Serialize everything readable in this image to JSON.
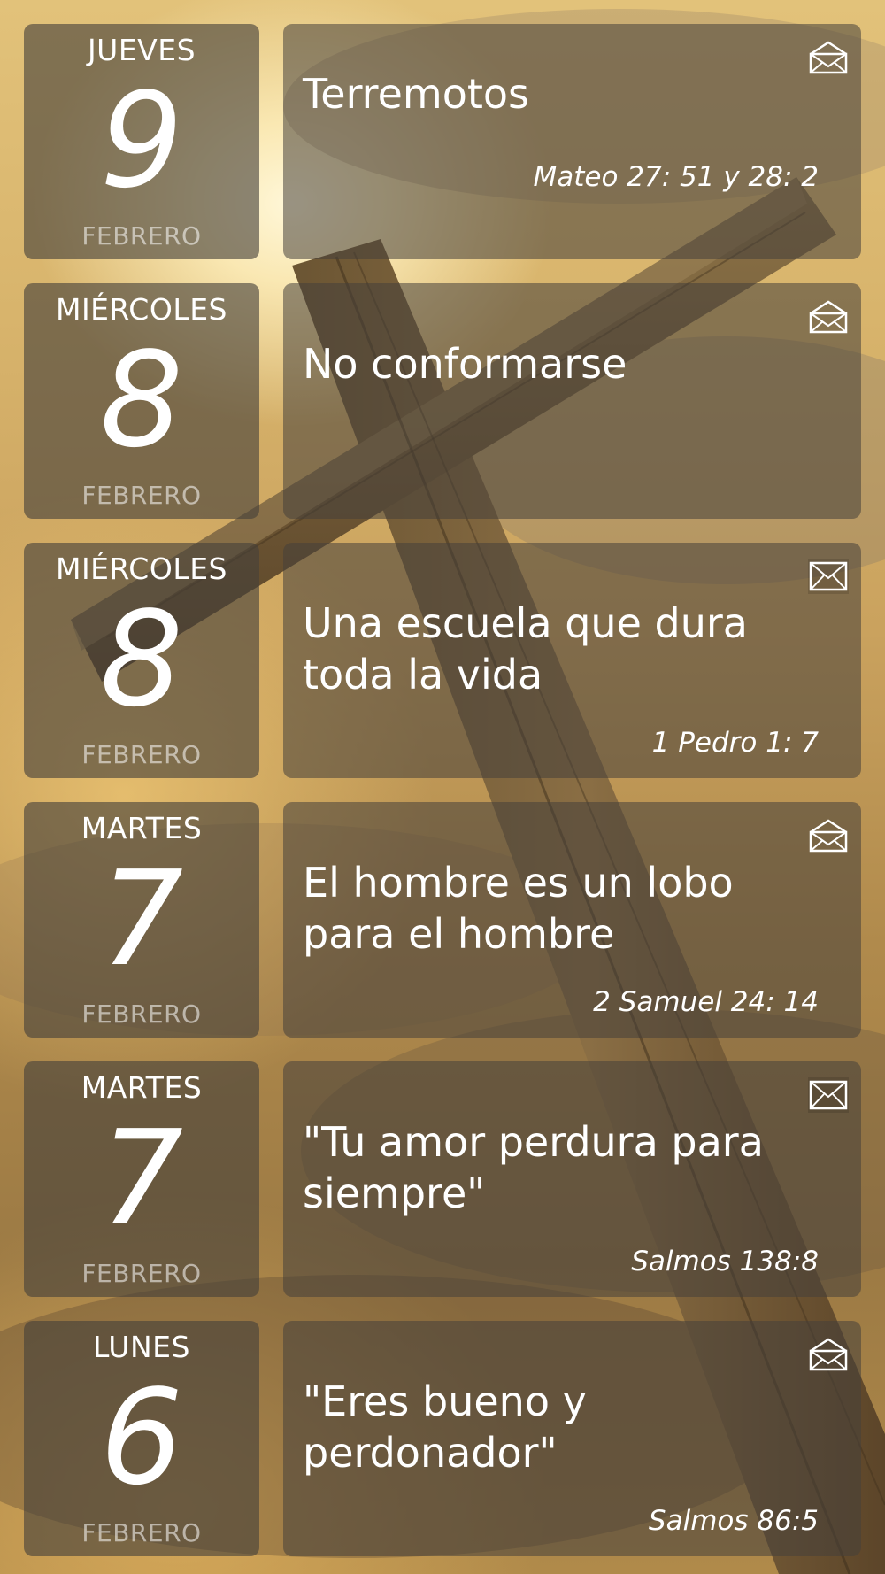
{
  "entries": [
    {
      "weekday": "JUEVES",
      "day": "9",
      "month": "FEBRERO",
      "title": "Terremotos",
      "reference": "Mateo 27: 51 y 28: 2",
      "envelope": "envelope-open-icon"
    },
    {
      "weekday": "MIÉRCOLES",
      "day": "8",
      "month": "FEBRERO",
      "title": "No conformarse",
      "reference": "",
      "envelope": "envelope-open-icon"
    },
    {
      "weekday": "MIÉRCOLES",
      "day": "8",
      "month": "FEBRERO",
      "title": "Una escuela que dura toda la vida",
      "reference": "1 Pedro 1: 7",
      "envelope": "envelope-closed-icon"
    },
    {
      "weekday": "MARTES",
      "day": "7",
      "month": "FEBRERO",
      "title": "El hombre es un lobo para el hombre",
      "reference": "2 Samuel 24: 14",
      "envelope": "envelope-open-icon"
    },
    {
      "weekday": "MARTES",
      "day": "7",
      "month": "FEBRERO",
      "title": "\"Tu amor perdura para siempre\"",
      "reference": "Salmos 138:8",
      "envelope": "envelope-closed-icon"
    },
    {
      "weekday": "LUNES",
      "day": "6",
      "month": "FEBRERO",
      "title": "\"Eres bueno y perdonador\"",
      "reference": "Salmos 86:5",
      "envelope": "envelope-open-icon"
    }
  ],
  "colors": {
    "card_bg": "#46403a",
    "text": "#ffffff",
    "month_text": "#bdb6ad"
  }
}
